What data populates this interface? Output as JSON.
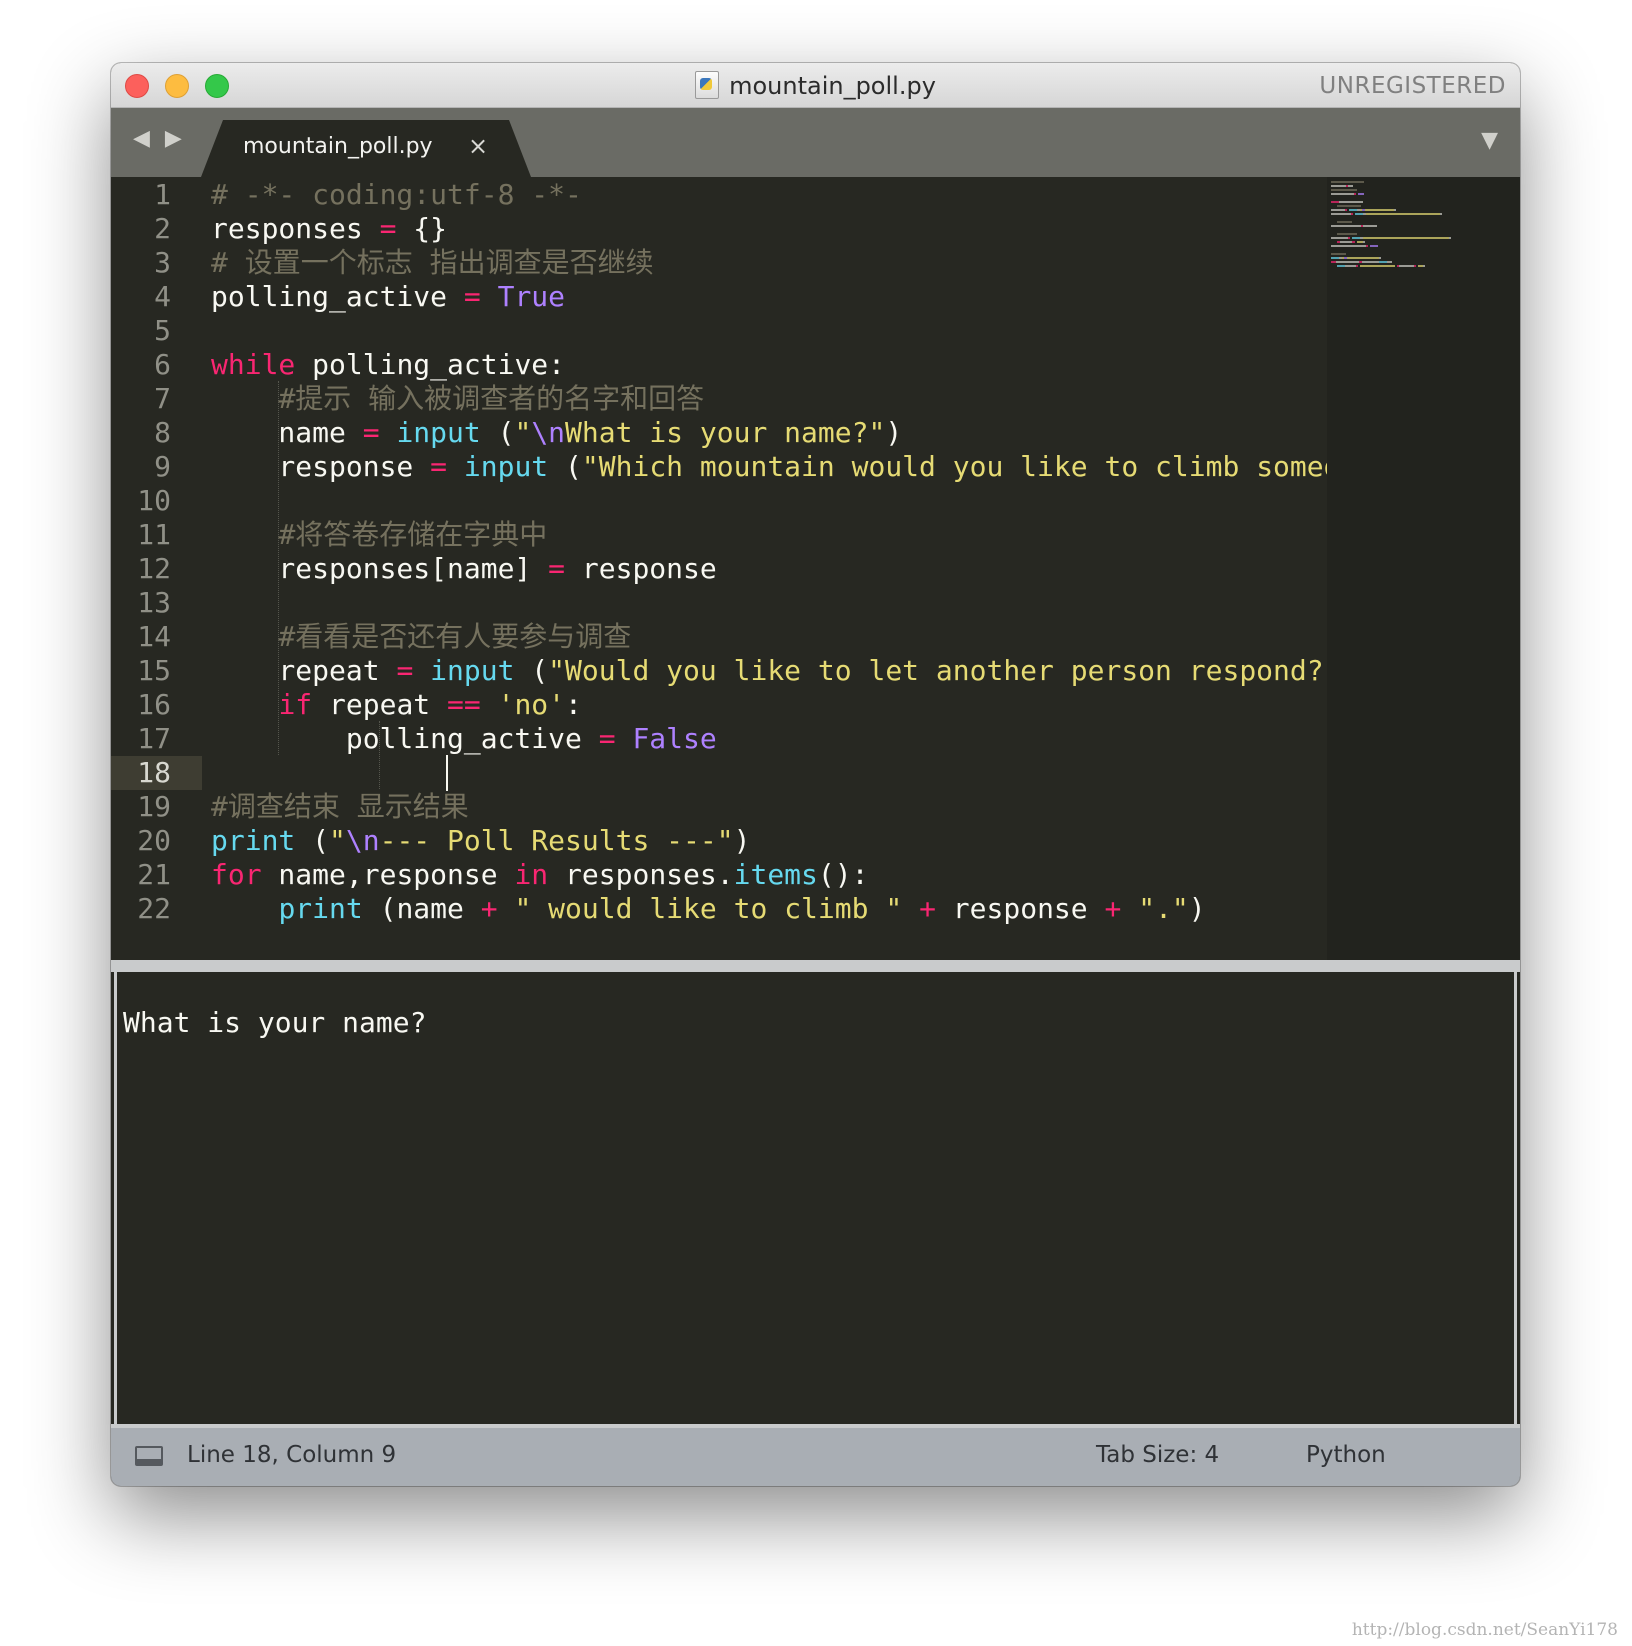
{
  "window": {
    "title": "mountain_poll.py",
    "registration": "UNREGISTERED"
  },
  "tab": {
    "label": "mountain_poll.py",
    "close": "×"
  },
  "icons": {
    "nav_arrows": "◀ ▶",
    "dropdown": "▼"
  },
  "editor": {
    "line_numbers": [
      "1",
      "2",
      "3",
      "4",
      "5",
      "6",
      "7",
      "8",
      "9",
      "10",
      "11",
      "12",
      "13",
      "14",
      "15",
      "16",
      "17",
      "18",
      "19",
      "20",
      "21",
      "22"
    ],
    "active_line": "18",
    "lines": [
      [
        {
          "t": "# -*- coding:utf-8 -*-",
          "c": "cmt"
        }
      ],
      [
        {
          "t": "responses "
        },
        {
          "t": "=",
          "c": "op"
        },
        {
          "t": " {}"
        }
      ],
      [
        {
          "t": "# 设置一个标志 指出调查是否继续",
          "c": "cmt"
        }
      ],
      [
        {
          "t": "polling_active "
        },
        {
          "t": "=",
          "c": "op"
        },
        {
          "t": " "
        },
        {
          "t": "True",
          "c": "const"
        }
      ],
      [],
      [
        {
          "t": "while",
          "c": "kw"
        },
        {
          "t": " polling_active:"
        }
      ],
      [
        {
          "t": "    "
        },
        {
          "t": "#提示 输入被调查者的名字和回答",
          "c": "cmt"
        }
      ],
      [
        {
          "t": "    name "
        },
        {
          "t": "=",
          "c": "op"
        },
        {
          "t": " "
        },
        {
          "t": "input",
          "c": "fn"
        },
        {
          "t": " ("
        },
        {
          "t": "\"",
          "c": "str"
        },
        {
          "t": "\\n",
          "c": "esc"
        },
        {
          "t": "What is your name?\"",
          "c": "str"
        },
        {
          "t": ")"
        }
      ],
      [
        {
          "t": "    response "
        },
        {
          "t": "=",
          "c": "op"
        },
        {
          "t": " "
        },
        {
          "t": "input",
          "c": "fn"
        },
        {
          "t": " ("
        },
        {
          "t": "\"Which mountain would you like to climb someday?\"",
          "c": "str"
        },
        {
          "t": ")"
        }
      ],
      [],
      [
        {
          "t": "    "
        },
        {
          "t": "#将答卷存储在字典中",
          "c": "cmt"
        }
      ],
      [
        {
          "t": "    responses[name] "
        },
        {
          "t": "=",
          "c": "op"
        },
        {
          "t": " response"
        }
      ],
      [],
      [
        {
          "t": "    "
        },
        {
          "t": "#看看是否还有人要参与调查",
          "c": "cmt"
        }
      ],
      [
        {
          "t": "    repeat "
        },
        {
          "t": "=",
          "c": "op"
        },
        {
          "t": " "
        },
        {
          "t": "input",
          "c": "fn"
        },
        {
          "t": " ("
        },
        {
          "t": "\"Would you like to let another person respond? (yes/no) \"",
          "c": "str"
        },
        {
          "t": ")"
        }
      ],
      [
        {
          "t": "    "
        },
        {
          "t": "if",
          "c": "kw"
        },
        {
          "t": " repeat "
        },
        {
          "t": "==",
          "c": "op"
        },
        {
          "t": " "
        },
        {
          "t": "'no'",
          "c": "str"
        },
        {
          "t": ":"
        }
      ],
      [
        {
          "t": "        polling_active "
        },
        {
          "t": "=",
          "c": "op"
        },
        {
          "t": " "
        },
        {
          "t": "False",
          "c": "const"
        }
      ],
      [],
      [
        {
          "t": "#调查结束 显示结果",
          "c": "cmt"
        }
      ],
      [
        {
          "t": "print",
          "c": "fn"
        },
        {
          "t": " ("
        },
        {
          "t": "\"",
          "c": "str"
        },
        {
          "t": "\\n",
          "c": "esc"
        },
        {
          "t": "--- Poll Results ---\"",
          "c": "str"
        },
        {
          "t": ")"
        }
      ],
      [
        {
          "t": "for",
          "c": "kw"
        },
        {
          "t": " name,response "
        },
        {
          "t": "in",
          "c": "kw"
        },
        {
          "t": " responses."
        },
        {
          "t": "items",
          "c": "fn"
        },
        {
          "t": "():"
        }
      ],
      [
        {
          "t": "    "
        },
        {
          "t": "print",
          "c": "fn"
        },
        {
          "t": " (name "
        },
        {
          "t": "+",
          "c": "op"
        },
        {
          "t": " "
        },
        {
          "t": "\" would like to climb \"",
          "c": "str"
        },
        {
          "t": " "
        },
        {
          "t": "+",
          "c": "op"
        },
        {
          "t": " response "
        },
        {
          "t": "+",
          "c": "op"
        },
        {
          "t": " "
        },
        {
          "t": "\".\"",
          "c": "str"
        },
        {
          "t": ")"
        }
      ]
    ]
  },
  "console": {
    "output": "What is your name?"
  },
  "status": {
    "position": "Line 18, Column 9",
    "tab_size": "Tab Size: 4",
    "syntax": "Python"
  },
  "colors": {
    "background": "#272822",
    "comment": "#75715e",
    "keyword": "#f92672",
    "function": "#66d9ef",
    "string": "#e6db74",
    "constant": "#ae81ff",
    "text": "#f8f8f2"
  },
  "watermark": "http://blog.csdn.net/SeanYi178"
}
